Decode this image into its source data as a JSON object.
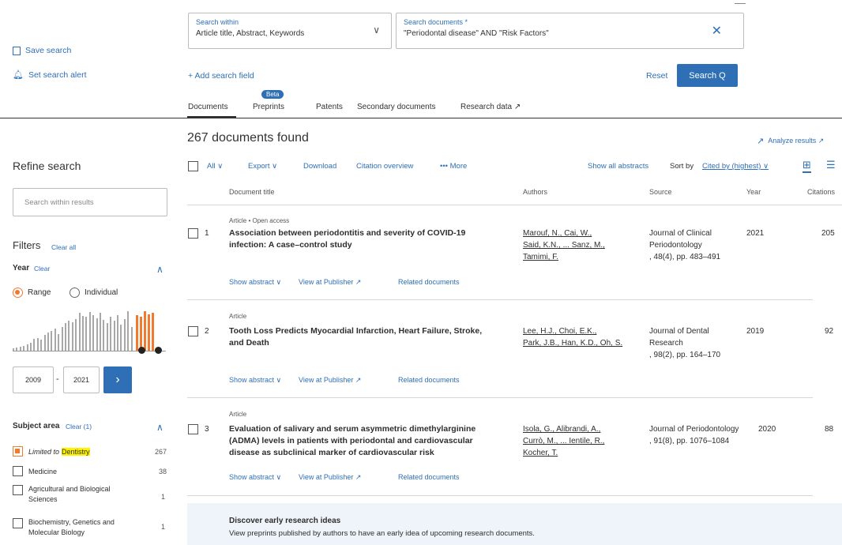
{
  "search": {
    "within_label": "Search within",
    "within_value": "Article title, Abstract, Keywords",
    "docs_label": "Search documents *",
    "docs_value": "\"Periodontal disease\" AND \"Risk Factors\"",
    "add_field": "+ Add search field",
    "reset": "Reset",
    "search_btn": "Search Q"
  },
  "left_actions": {
    "save_search": "Save search",
    "set_alert": "Set search alert"
  },
  "tabs": {
    "documents": "Documents",
    "preprints": "Preprints",
    "beta": "Beta",
    "patents": "Patents",
    "secondary": "Secondary documents",
    "research_data": "Research data ↗"
  },
  "results": {
    "count_text": "267 documents found",
    "analyze": "Analyze results ↗",
    "toolbar": {
      "all": "All ∨",
      "export": "Export ∨",
      "download": "Download",
      "citation_overview": "Citation overview",
      "more": "••• More",
      "show_all_abstracts": "Show all abstracts",
      "sort_by": "Sort by",
      "sort_value": "Cited by (highest) ∨"
    },
    "columns": {
      "doc_title": "Document title",
      "authors": "Authors",
      "source": "Source",
      "year": "Year",
      "citations": "Citations"
    },
    "rows": [
      {
        "num": "1",
        "type": "Article • Open access",
        "title1": "Association between periodontitis and severity of COVID-19",
        "title2": "infection: A case–control study",
        "title3": "",
        "authors1": "Marouf, N., Cai, W.,",
        "authors2": "Said, K.N., ... Sanz, M.,",
        "authors3": "Tamimi, F.",
        "source1": "Journal of Clinical",
        "source2": "Periodontology",
        "source3": ", 48(4), pp. 483–491",
        "year": "2021",
        "citations": "205",
        "show_abstract": "Show abstract ∨",
        "view_publisher": "View at Publisher ↗",
        "related": "Related documents"
      },
      {
        "num": "2",
        "type": "Article",
        "title1": "Tooth Loss Predicts Myocardial Infarction, Heart Failure, Stroke,",
        "title2": "and Death",
        "title3": "",
        "authors1": "Lee, H.J., Choi, E.K.,",
        "authors2": "Park, J.B., Han, K.D., Oh, S.",
        "authors3": "",
        "source1": "Journal of Dental",
        "source2": "Research",
        "source3": ", 98(2), pp. 164–170",
        "year": "2019",
        "citations": "92",
        "show_abstract": "Show abstract ∨",
        "view_publisher": "View at Publisher ↗",
        "related": "Related documents"
      },
      {
        "num": "3",
        "type": "Article",
        "title1": "Evaluation of salivary and serum asymmetric dimethylarginine",
        "title2": "(ADMA) levels in patients with periodontal and cardiovascular",
        "title3": "disease as subclinical marker of cardiovascular risk",
        "authors1": "Isola, G., Alibrandi, A.,",
        "authors2": "Currò, M., ... Ientile, R.,",
        "authors3": "Kocher, T.",
        "source1": "Journal of Periodontology",
        "source2": ", 91(8), pp. 1076–1084",
        "source3": "",
        "year": "2020",
        "citations": "88",
        "show_abstract": "Show abstract ∨",
        "view_publisher": "View at Publisher ↗",
        "related": "Related documents"
      }
    ],
    "discover_title": "Discover early research ideas",
    "discover_text": "View preprints published by authors to have an early idea of upcoming research documents."
  },
  "sidebar": {
    "refine": "Refine search",
    "search_within_placeholder": "Search within results",
    "filters": "Filters",
    "clear_all": "Clear all",
    "year": "Year",
    "year_clear": "Clear",
    "range": "Range",
    "individual": "Individual",
    "year_from": "2009",
    "dash": "-",
    "year_to": "2021",
    "histogram": [
      0.05,
      0.07,
      0.1,
      0.12,
      0.15,
      0.2,
      0.3,
      0.32,
      0.28,
      0.4,
      0.45,
      0.5,
      0.55,
      0.42,
      0.6,
      0.7,
      0.75,
      0.72,
      0.8,
      0.95,
      0.88,
      0.85,
      0.98,
      0.9,
      0.82,
      0.95,
      0.78,
      0.7,
      0.85,
      0.75,
      0.9,
      0.65,
      0.8,
      1.0,
      0.6
    ],
    "histogram_selected": [
      0.9,
      0.85,
      1.0,
      0.92,
      0.95
    ],
    "subject_area": "Subject area",
    "subject_clear": "Clear (1)",
    "limited_to": "Limited to",
    "dentistry": "Dentistry",
    "dentistry_count": "267",
    "subjects": [
      {
        "label": "Medicine",
        "count": "38"
      },
      {
        "label1": "Agricultural and Biological",
        "label2": "Sciences",
        "count": "1"
      },
      {
        "label1": "Biochemistry, Genetics and",
        "label2": "Molecular Biology",
        "count": "1"
      }
    ],
    "accent": "#f07a2f",
    "primary": "#2e6fb5"
  }
}
